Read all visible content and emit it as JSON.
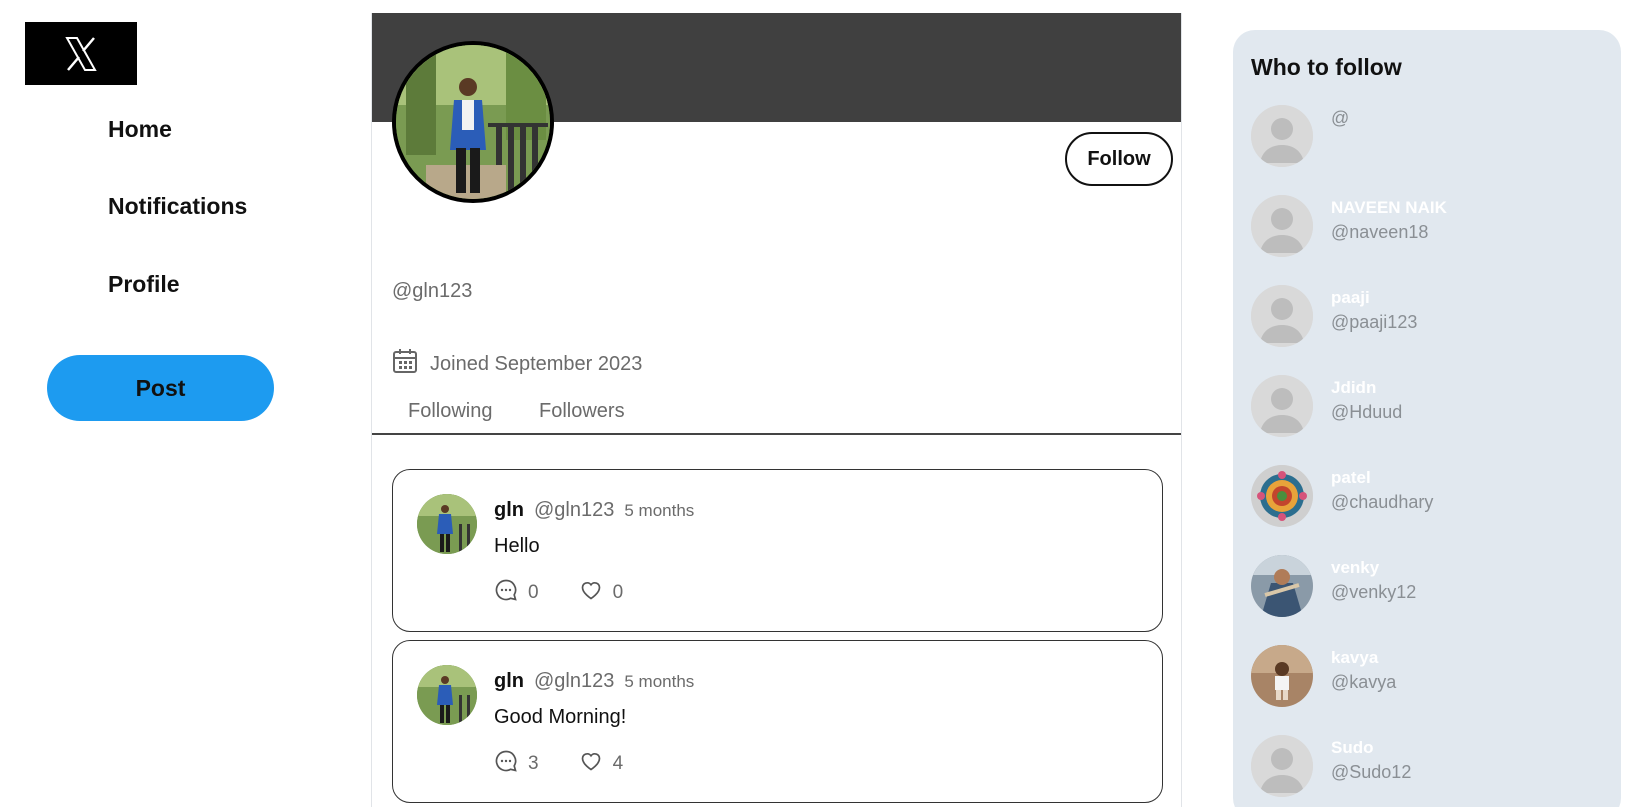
{
  "logo": {
    "icon": "x-logo-icon"
  },
  "nav": {
    "home": "Home",
    "notifications": "Notifications",
    "profile": "Profile",
    "post": "Post"
  },
  "profile": {
    "follow_label": "Follow",
    "handle": "@gln123",
    "joined": "Joined September 2023",
    "tabs": {
      "following": "Following",
      "followers": "Followers"
    }
  },
  "tweets": [
    {
      "name": "gln",
      "handle": "@gln123",
      "time": "5 months",
      "text": "Hello",
      "replies": "0",
      "likes": "0"
    },
    {
      "name": "gln",
      "handle": "@gln123",
      "time": "5 months",
      "text": "Good Morning!",
      "replies": "3",
      "likes": "4"
    }
  ],
  "who_to_follow": {
    "title": "Who to follow",
    "users": [
      {
        "name": "",
        "handle": "@"
      },
      {
        "name": "NAVEEN NAIK",
        "handle": "@naveen18"
      },
      {
        "name": "paaji",
        "handle": "@paaji123"
      },
      {
        "name": "Jdidn",
        "handle": "@Hduud"
      },
      {
        "name": "patel",
        "handle": "@chaudhary"
      },
      {
        "name": "venky",
        "handle": "@venky12"
      },
      {
        "name": "kavya",
        "handle": "@kavya"
      },
      {
        "name": "Sudo",
        "handle": "@Sudo12"
      }
    ]
  },
  "colors": {
    "accent": "#1d9bf0",
    "banner": "#404040",
    "sidebar_bg": "#e1e8ef"
  }
}
